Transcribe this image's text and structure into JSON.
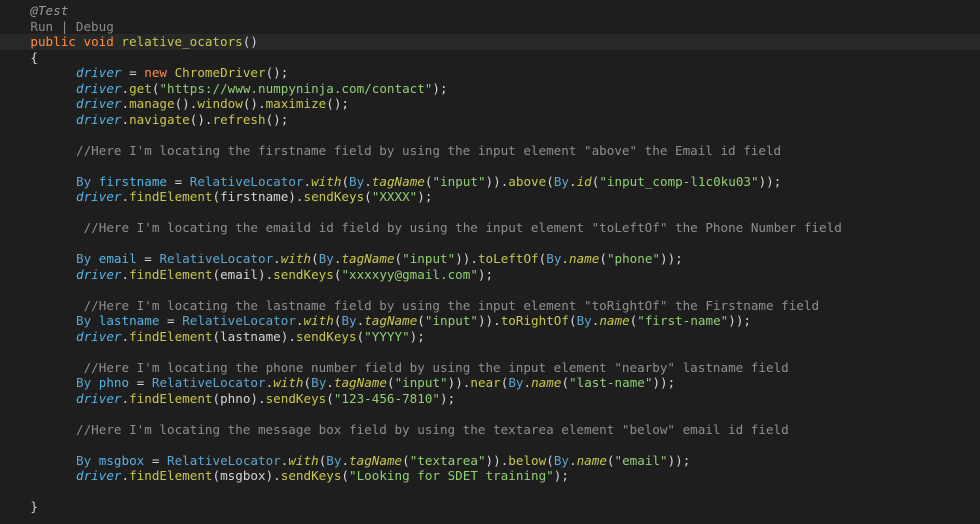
{
  "colors": {
    "background": "#1e1e1e",
    "current_line": "#282828",
    "plain": "#d4d4d4",
    "keyword": "#ff8c3f",
    "variable": "#53b5e4",
    "type": "#5aa6cf",
    "method": "#c8c84b",
    "string": "#90cf73",
    "comment": "#8e8e8e",
    "annotation": "#9a9a9a",
    "codelens": "#8a8a8a"
  },
  "lines": [
    {
      "indent": 4,
      "tokens": [
        {
          "t": "@Test",
          "c": "annotation",
          "i": true
        }
      ]
    },
    {
      "indent": 4,
      "tokens": [
        {
          "t": "Run | Debug",
          "c": "codelens"
        }
      ]
    },
    {
      "indent": 4,
      "current": true,
      "tokens": [
        {
          "t": "public",
          "c": "keyword"
        },
        {
          "t": " "
        },
        {
          "t": "void",
          "c": "keyword"
        },
        {
          "t": " "
        },
        {
          "t": "relative_ocators",
          "c": "method"
        },
        {
          "t": "()"
        }
      ]
    },
    {
      "indent": 4,
      "tokens": [
        {
          "t": "{"
        }
      ]
    },
    {
      "indent": 10,
      "tokens": [
        {
          "t": "driver",
          "c": "variable",
          "i": true
        },
        {
          "t": " = "
        },
        {
          "t": "new",
          "c": "keyword"
        },
        {
          "t": " "
        },
        {
          "t": "ChromeDriver",
          "c": "method"
        },
        {
          "t": "();"
        }
      ]
    },
    {
      "indent": 10,
      "tokens": [
        {
          "t": "driver",
          "c": "variable",
          "i": true
        },
        {
          "t": "."
        },
        {
          "t": "get",
          "c": "method"
        },
        {
          "t": "("
        },
        {
          "t": "\"https://www.numpyninja.com/contact\"",
          "c": "string"
        },
        {
          "t": ");"
        }
      ]
    },
    {
      "indent": 10,
      "tokens": [
        {
          "t": "driver",
          "c": "variable",
          "i": true
        },
        {
          "t": "."
        },
        {
          "t": "manage",
          "c": "method"
        },
        {
          "t": "()."
        },
        {
          "t": "window",
          "c": "method"
        },
        {
          "t": "()."
        },
        {
          "t": "maximize",
          "c": "method"
        },
        {
          "t": "();"
        }
      ]
    },
    {
      "indent": 10,
      "tokens": [
        {
          "t": "driver",
          "c": "variable",
          "i": true
        },
        {
          "t": "."
        },
        {
          "t": "navigate",
          "c": "method"
        },
        {
          "t": "()."
        },
        {
          "t": "refresh",
          "c": "method"
        },
        {
          "t": "();"
        }
      ]
    },
    {
      "indent": 0,
      "tokens": []
    },
    {
      "indent": 10,
      "tokens": [
        {
          "t": "//Here I'm locating the firstname field by using the input element \"above\" the Email id field",
          "c": "comment"
        }
      ]
    },
    {
      "indent": 0,
      "tokens": []
    },
    {
      "indent": 10,
      "tokens": [
        {
          "t": "By",
          "c": "type"
        },
        {
          "t": " "
        },
        {
          "t": "firstname",
          "c": "variable"
        },
        {
          "t": " = "
        },
        {
          "t": "RelativeLocator",
          "c": "type"
        },
        {
          "t": "."
        },
        {
          "t": "with",
          "c": "method",
          "i": true
        },
        {
          "t": "("
        },
        {
          "t": "By",
          "c": "type"
        },
        {
          "t": "."
        },
        {
          "t": "tagName",
          "c": "method",
          "i": true
        },
        {
          "t": "("
        },
        {
          "t": "\"input\"",
          "c": "string"
        },
        {
          "t": "))."
        },
        {
          "t": "above",
          "c": "method"
        },
        {
          "t": "("
        },
        {
          "t": "By",
          "c": "type"
        },
        {
          "t": "."
        },
        {
          "t": "id",
          "c": "method",
          "i": true
        },
        {
          "t": "("
        },
        {
          "t": "\"input_comp-l1c0ku03\"",
          "c": "string"
        },
        {
          "t": "));"
        }
      ]
    },
    {
      "indent": 10,
      "tokens": [
        {
          "t": "driver",
          "c": "variable",
          "i": true
        },
        {
          "t": "."
        },
        {
          "t": "findElement",
          "c": "method"
        },
        {
          "t": "(firstname)."
        },
        {
          "t": "sendKeys",
          "c": "method"
        },
        {
          "t": "("
        },
        {
          "t": "\"XXXX\"",
          "c": "string"
        },
        {
          "t": ");"
        }
      ]
    },
    {
      "indent": 0,
      "tokens": []
    },
    {
      "indent": 11,
      "tokens": [
        {
          "t": "//Here I'm locating the emaild id field by using the input element \"toLeftOf\" the Phone Number field",
          "c": "comment"
        }
      ]
    },
    {
      "indent": 0,
      "tokens": []
    },
    {
      "indent": 10,
      "tokens": [
        {
          "t": "By",
          "c": "type"
        },
        {
          "t": " "
        },
        {
          "t": "email",
          "c": "variable"
        },
        {
          "t": " = "
        },
        {
          "t": "RelativeLocator",
          "c": "type"
        },
        {
          "t": "."
        },
        {
          "t": "with",
          "c": "method",
          "i": true
        },
        {
          "t": "("
        },
        {
          "t": "By",
          "c": "type"
        },
        {
          "t": "."
        },
        {
          "t": "tagName",
          "c": "method",
          "i": true
        },
        {
          "t": "("
        },
        {
          "t": "\"input\"",
          "c": "string"
        },
        {
          "t": "))."
        },
        {
          "t": "toLeftOf",
          "c": "method"
        },
        {
          "t": "("
        },
        {
          "t": "By",
          "c": "type"
        },
        {
          "t": "."
        },
        {
          "t": "name",
          "c": "method",
          "i": true
        },
        {
          "t": "("
        },
        {
          "t": "\"phone\"",
          "c": "string"
        },
        {
          "t": "));"
        }
      ]
    },
    {
      "indent": 10,
      "tokens": [
        {
          "t": "driver",
          "c": "variable",
          "i": true
        },
        {
          "t": "."
        },
        {
          "t": "findElement",
          "c": "method"
        },
        {
          "t": "(email)."
        },
        {
          "t": "sendKeys",
          "c": "method"
        },
        {
          "t": "("
        },
        {
          "t": "\"xxxxyy@gmail.com\"",
          "c": "string"
        },
        {
          "t": ");"
        }
      ]
    },
    {
      "indent": 0,
      "tokens": []
    },
    {
      "indent": 11,
      "tokens": [
        {
          "t": "//Here I'm locating the lastname field by using the input element \"toRightOf\" the Firstname field",
          "c": "comment"
        }
      ]
    },
    {
      "indent": 10,
      "tokens": [
        {
          "t": "By",
          "c": "type"
        },
        {
          "t": " "
        },
        {
          "t": "lastname",
          "c": "variable"
        },
        {
          "t": " = "
        },
        {
          "t": "RelativeLocator",
          "c": "type"
        },
        {
          "t": "."
        },
        {
          "t": "with",
          "c": "method",
          "i": true
        },
        {
          "t": "("
        },
        {
          "t": "By",
          "c": "type"
        },
        {
          "t": "."
        },
        {
          "t": "tagName",
          "c": "method",
          "i": true
        },
        {
          "t": "("
        },
        {
          "t": "\"input\"",
          "c": "string"
        },
        {
          "t": "))."
        },
        {
          "t": "toRightOf",
          "c": "method"
        },
        {
          "t": "("
        },
        {
          "t": "By",
          "c": "type"
        },
        {
          "t": "."
        },
        {
          "t": "name",
          "c": "method",
          "i": true
        },
        {
          "t": "("
        },
        {
          "t": "\"first-name\"",
          "c": "string"
        },
        {
          "t": "));"
        }
      ]
    },
    {
      "indent": 10,
      "tokens": [
        {
          "t": "driver",
          "c": "variable",
          "i": true
        },
        {
          "t": "."
        },
        {
          "t": "findElement",
          "c": "method"
        },
        {
          "t": "(lastname)."
        },
        {
          "t": "sendKeys",
          "c": "method"
        },
        {
          "t": "("
        },
        {
          "t": "\"YYYY\"",
          "c": "string"
        },
        {
          "t": ");"
        }
      ]
    },
    {
      "indent": 0,
      "tokens": []
    },
    {
      "indent": 11,
      "tokens": [
        {
          "t": "//Here I'm locating the phone number field by using the input element \"nearby\" lastname field",
          "c": "comment"
        }
      ]
    },
    {
      "indent": 10,
      "tokens": [
        {
          "t": "By",
          "c": "type"
        },
        {
          "t": " "
        },
        {
          "t": "phno",
          "c": "variable"
        },
        {
          "t": " = "
        },
        {
          "t": "RelativeLocator",
          "c": "type"
        },
        {
          "t": "."
        },
        {
          "t": "with",
          "c": "method",
          "i": true
        },
        {
          "t": "("
        },
        {
          "t": "By",
          "c": "type"
        },
        {
          "t": "."
        },
        {
          "t": "tagName",
          "c": "method",
          "i": true
        },
        {
          "t": "("
        },
        {
          "t": "\"input\"",
          "c": "string"
        },
        {
          "t": "))."
        },
        {
          "t": "near",
          "c": "method"
        },
        {
          "t": "("
        },
        {
          "t": "By",
          "c": "type"
        },
        {
          "t": "."
        },
        {
          "t": "name",
          "c": "method",
          "i": true
        },
        {
          "t": "("
        },
        {
          "t": "\"last-name\"",
          "c": "string"
        },
        {
          "t": "));"
        }
      ]
    },
    {
      "indent": 10,
      "tokens": [
        {
          "t": "driver",
          "c": "variable",
          "i": true
        },
        {
          "t": "."
        },
        {
          "t": "findElement",
          "c": "method"
        },
        {
          "t": "(phno)."
        },
        {
          "t": "sendKeys",
          "c": "method"
        },
        {
          "t": "("
        },
        {
          "t": "\"123-456-7810\"",
          "c": "string"
        },
        {
          "t": ");"
        }
      ]
    },
    {
      "indent": 0,
      "tokens": []
    },
    {
      "indent": 10,
      "tokens": [
        {
          "t": "//Here I'm locating the message box field by using the textarea element \"below\" email id field",
          "c": "comment"
        }
      ]
    },
    {
      "indent": 0,
      "tokens": []
    },
    {
      "indent": 10,
      "tokens": [
        {
          "t": "By",
          "c": "type"
        },
        {
          "t": " "
        },
        {
          "t": "msgbox",
          "c": "variable"
        },
        {
          "t": " = "
        },
        {
          "t": "RelativeLocator",
          "c": "type"
        },
        {
          "t": "."
        },
        {
          "t": "with",
          "c": "method",
          "i": true
        },
        {
          "t": "("
        },
        {
          "t": "By",
          "c": "type"
        },
        {
          "t": "."
        },
        {
          "t": "tagName",
          "c": "method",
          "i": true
        },
        {
          "t": "("
        },
        {
          "t": "\"textarea\"",
          "c": "string"
        },
        {
          "t": "))."
        },
        {
          "t": "below",
          "c": "method"
        },
        {
          "t": "("
        },
        {
          "t": "By",
          "c": "type"
        },
        {
          "t": "."
        },
        {
          "t": "name",
          "c": "method",
          "i": true
        },
        {
          "t": "("
        },
        {
          "t": "\"email\"",
          "c": "string"
        },
        {
          "t": "));"
        }
      ]
    },
    {
      "indent": 10,
      "tokens": [
        {
          "t": "driver",
          "c": "variable",
          "i": true
        },
        {
          "t": "."
        },
        {
          "t": "findElement",
          "c": "method"
        },
        {
          "t": "(msgbox)."
        },
        {
          "t": "sendKeys",
          "c": "method"
        },
        {
          "t": "("
        },
        {
          "t": "\"Looking for SDET training\"",
          "c": "string"
        },
        {
          "t": ");"
        }
      ]
    },
    {
      "indent": 0,
      "tokens": []
    },
    {
      "indent": 4,
      "tokens": [
        {
          "t": "}"
        }
      ]
    }
  ]
}
